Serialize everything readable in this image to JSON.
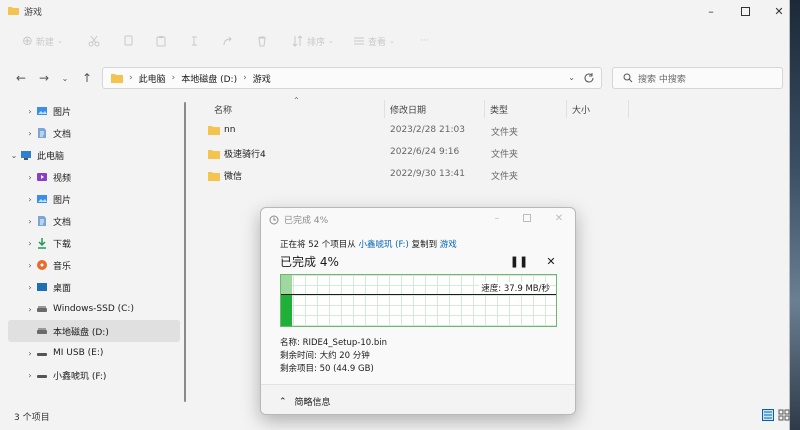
{
  "window": {
    "title": "游戏"
  },
  "toolbar": {
    "new_label": "新建",
    "sort_label": "排序",
    "view_label": "查看",
    "more_label": "···"
  },
  "address": {
    "crumbs": [
      "此电脑",
      "本地磁盘 (D:)",
      "游戏"
    ],
    "search_placeholder": "搜索 中搜索"
  },
  "sidebar": {
    "items": [
      {
        "label": "图片",
        "icon": "pictures-icon"
      },
      {
        "label": "文档",
        "icon": "documents-icon"
      },
      {
        "label": "此电脑",
        "icon": "this-pc-icon"
      },
      {
        "label": "视频",
        "icon": "videos-icon"
      },
      {
        "label": "图片",
        "icon": "pictures-icon"
      },
      {
        "label": "文档",
        "icon": "documents-icon"
      },
      {
        "label": "下载",
        "icon": "downloads-icon"
      },
      {
        "label": "音乐",
        "icon": "music-icon"
      },
      {
        "label": "桌面",
        "icon": "desktop-icon"
      },
      {
        "label": "Windows-SSD (C:)",
        "icon": "drive-icon"
      },
      {
        "label": "本地磁盘 (D:)",
        "icon": "drive-icon"
      },
      {
        "label": "MI USB (E:)",
        "icon": "usb-drive-icon"
      },
      {
        "label": "小鑫唬玑 (F:)",
        "icon": "usb-drive-icon"
      }
    ]
  },
  "columns": {
    "name": "名称",
    "date": "修改日期",
    "type": "类型",
    "size": "大小"
  },
  "files": [
    {
      "name": "nn",
      "date": "2023/2/28 21:03",
      "type": "文件夹"
    },
    {
      "name": "极速骑行4",
      "date": "2022/6/24 9:16",
      "type": "文件夹"
    },
    {
      "name": "微信",
      "date": "2022/9/30 13:41",
      "type": "文件夹"
    }
  ],
  "status": {
    "count": "3 个项目"
  },
  "copy_dialog": {
    "title": "已完成 4%",
    "line_prefix": "正在将 52 个项目从",
    "source": "小鑫唬玑 (F:)",
    "line_mid": "复制到",
    "dest": "游戏",
    "percent_text": "已完成 4%",
    "progress_fraction": 0.04,
    "speed": "速度: 37.9 MB/秒",
    "name_line": "名称: RIDE4_Setup-10.bin",
    "time_line": "剩余时间: 大约 20 分钟",
    "items_line": "剩余项目: 50 (44.9 GB)",
    "less_details": "简略信息",
    "pause_icon": "pause-icon",
    "close_icon": "close-icon"
  },
  "colors": {
    "accent": "#0063b1",
    "progress_green": "#1fb03a",
    "folder": "#f4c44e"
  }
}
